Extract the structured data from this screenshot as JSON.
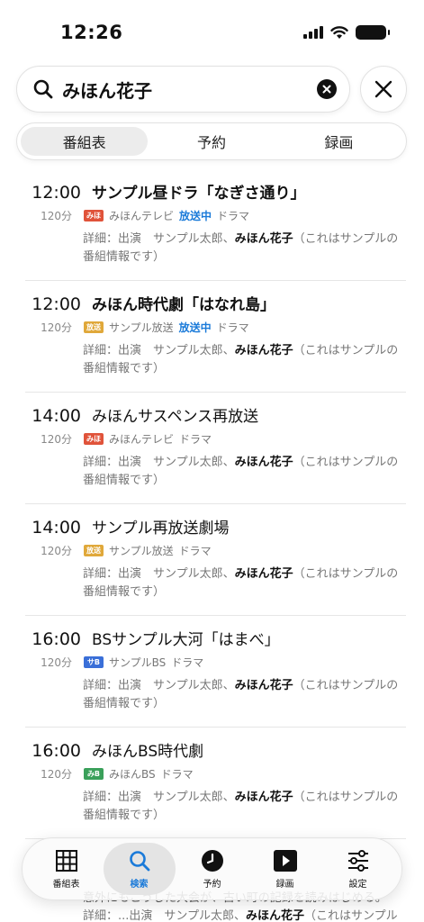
{
  "status": {
    "time": "12:26"
  },
  "search": {
    "query": "みほん花子"
  },
  "tabs": [
    {
      "label": "番組表",
      "active": true
    },
    {
      "label": "予約",
      "active": false
    },
    {
      "label": "録画",
      "active": false
    }
  ],
  "programs": [
    {
      "time": "12:00",
      "title": "サンプル昼ドラ「なぎさ通り」",
      "bold": true,
      "duration": "120分",
      "badge": "みほ",
      "badge_color": "#e0533a",
      "channel": "みほんテレビ",
      "live": "放送中",
      "genre": "ドラマ",
      "detail_pre": "詳細：出演　サンプル太郎、",
      "detail_name": "みほん花子",
      "detail_post": "（これはサンプルの番組情報です）"
    },
    {
      "time": "12:00",
      "title": "みほん時代劇「はなれ島」",
      "bold": true,
      "duration": "120分",
      "badge": "放送",
      "badge_color": "#e0a83a",
      "channel": "サンプル放送",
      "live": "放送中",
      "genre": "ドラマ",
      "detail_pre": "詳細：出演　サンプル太郎、",
      "detail_name": "みほん花子",
      "detail_post": "（これはサンプルの番組情報です）"
    },
    {
      "time": "14:00",
      "title": "みほんサスペンス再放送",
      "bold": false,
      "duration": "120分",
      "badge": "みほ",
      "badge_color": "#e0533a",
      "channel": "みほんテレビ",
      "live": "",
      "genre": "ドラマ",
      "detail_pre": "詳細：出演　サンプル太郎、",
      "detail_name": "みほん花子",
      "detail_post": "（これはサンプルの番組情報です）"
    },
    {
      "time": "14:00",
      "title": "サンプル再放送劇場",
      "bold": false,
      "duration": "120分",
      "badge": "放送",
      "badge_color": "#e0a83a",
      "channel": "サンプル放送",
      "live": "",
      "genre": "ドラマ",
      "detail_pre": "詳細：出演　サンプル太郎、",
      "detail_name": "みほん花子",
      "detail_post": "（これはサンプルの番組情報です）"
    },
    {
      "time": "16:00",
      "title": "BSサンプル大河「はまべ」",
      "bold": false,
      "duration": "120分",
      "badge": "サB",
      "badge_color": "#3a6fd8",
      "channel": "サンプルBS",
      "live": "",
      "genre": "ドラマ",
      "detail_pre": "詳細：出演　サンプル太郎、",
      "detail_name": "みほん花子",
      "detail_post": "（これはサンプルの番組情報です）"
    },
    {
      "time": "16:00",
      "title": "みほんBS時代劇",
      "bold": false,
      "duration": "120分",
      "badge": "みB",
      "badge_color": "#3aa05a",
      "channel": "みほんBS",
      "live": "",
      "genre": "ドラマ",
      "detail_pre": "詳細：出演　サンプル太郎、",
      "detail_name": "みほん花子",
      "detail_post": "（これはサンプルの番組情報です）"
    }
  ],
  "partial": {
    "desc_line1": "意外にもこうした大会が、古い町の記録を読みはじめる。",
    "detail_pre": "詳細：...出演　サンプル太郎、",
    "detail_name": "みほん花子",
    "detail_post": "（これはサンプル"
  },
  "tabbar": [
    {
      "label": "番組表",
      "icon": "grid-icon",
      "active": false
    },
    {
      "label": "検索",
      "icon": "search-icon",
      "active": true
    },
    {
      "label": "予約",
      "icon": "clock-icon",
      "active": false
    },
    {
      "label": "録画",
      "icon": "play-icon",
      "active": false
    },
    {
      "label": "設定",
      "icon": "sliders-icon",
      "active": false
    }
  ]
}
